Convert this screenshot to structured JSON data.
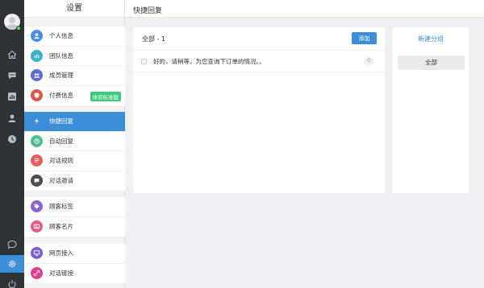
{
  "panel": {
    "title": "设置"
  },
  "header": {
    "title": "快捷回复"
  },
  "groups": [
    {
      "items": [
        {
          "label": "个人信息",
          "icon": "user-icon",
          "color": "#4a90e2"
        },
        {
          "label": "团队信息",
          "icon": "chart-icon",
          "color": "#37b3c8"
        },
        {
          "label": "成员管理",
          "icon": "members-icon",
          "color": "#5b6bd6"
        },
        {
          "label": "付费信息",
          "icon": "shield-icon",
          "color": "#e0564b",
          "badge": "体验标准版"
        }
      ]
    },
    {
      "items": [
        {
          "label": "快捷回复",
          "icon": "lightning-icon",
          "color": "#3d8ed8",
          "active": true
        },
        {
          "label": "自动回复",
          "icon": "auto-reply-icon",
          "color": "#4fc08d"
        },
        {
          "label": "对话规则",
          "icon": "rules-icon",
          "color": "#ea5d5d"
        },
        {
          "label": "对话邀请",
          "icon": "invite-icon",
          "color": "#4a4f57"
        }
      ]
    },
    {
      "items": [
        {
          "label": "顾客标签",
          "icon": "tag-icon",
          "color": "#8a62d2"
        },
        {
          "label": "顾客名片",
          "icon": "card-icon",
          "color": "#ea5b8a"
        }
      ]
    },
    {
      "items": [
        {
          "label": "网页接入",
          "icon": "monitor-icon",
          "color": "#7b5fd6"
        },
        {
          "label": "对话链接",
          "icon": "link-icon",
          "color": "#e23f8a"
        }
      ]
    }
  ],
  "reply_card": {
    "count_label": "全部 - 1",
    "add_button": "添加",
    "replies": [
      {
        "text": "好的，请稍等，为您查询下订单的情况。。",
        "count": "0"
      }
    ]
  },
  "group_card": {
    "new_group": "新建分组",
    "all_label": "全部"
  },
  "accent": "#3d8ed8"
}
